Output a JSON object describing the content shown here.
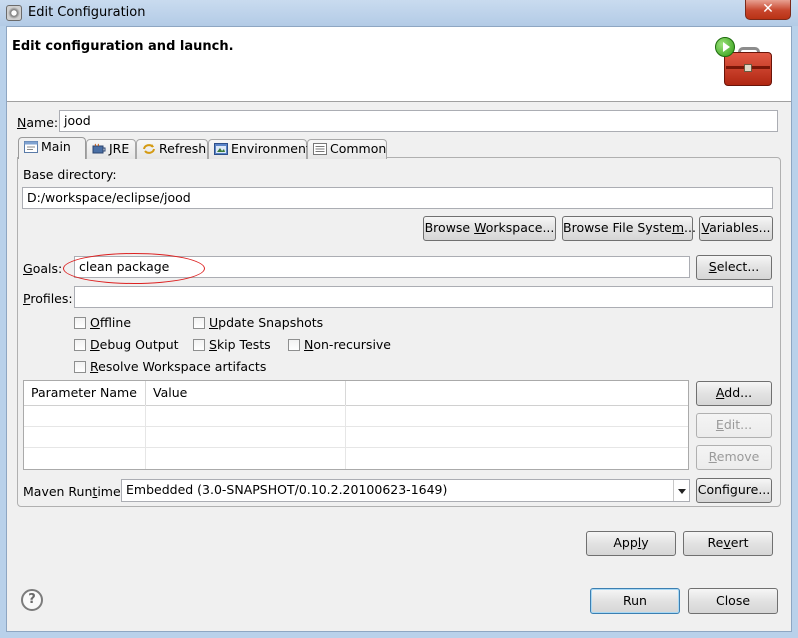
{
  "window": {
    "title": "Edit Configuration",
    "close_glyph": "✕"
  },
  "header": {
    "title": "Edit configuration and launch.",
    "icons": [
      "run-icon",
      "toolbox-icon"
    ]
  },
  "name": {
    "label_u": "N",
    "label_rest": "ame:",
    "value": "jood"
  },
  "tabs": [
    {
      "label": "Main",
      "icon": "main-tab-icon",
      "active": true
    },
    {
      "label": "JRE",
      "icon": "jre-icon",
      "active": false
    },
    {
      "label": "Refresh",
      "icon": "refresh-icon",
      "active": false
    },
    {
      "label": "Environment",
      "icon": "environment-icon",
      "active": false
    },
    {
      "label": "Common",
      "icon": "common-icon",
      "active": false
    }
  ],
  "main": {
    "base_dir_label": "Base directory:",
    "base_dir_value": "D:/workspace/eclipse/jood",
    "browse_workspace": {
      "pre": "Browse ",
      "u": "W",
      "post": "orkspace..."
    },
    "browse_filesystem": {
      "pre": "Browse File Syste",
      "u": "m",
      "post": "..."
    },
    "variables": {
      "pre": "",
      "u": "V",
      "post": "ariables..."
    },
    "goals_label": {
      "u": "G",
      "rest": "oals:"
    },
    "goals_value": "clean package",
    "select_button": {
      "u": "S",
      "rest": "elect..."
    },
    "profiles_label": {
      "u": "P",
      "rest": "rofiles:"
    },
    "profiles_value": "",
    "checkboxes": {
      "offline": {
        "u": "O",
        "rest": "ffline",
        "checked": false
      },
      "update_snapshots": {
        "u": "U",
        "rest": "pdate Snapshots",
        "checked": false
      },
      "debug_output": {
        "u": "D",
        "rest": "ebug Output",
        "checked": false
      },
      "skip_tests": {
        "u": "S",
        "rest": "kip Tests",
        "checked": false
      },
      "non_recursive": {
        "u": "N",
        "rest": "on-recursive",
        "checked": false
      },
      "resolve_workspace": {
        "u": "R",
        "rest": "esolve Workspace artifacts",
        "checked": false
      }
    },
    "params_table": {
      "columns": [
        "Parameter Name",
        "Value",
        ""
      ],
      "rows": []
    },
    "add_button": {
      "u": "A",
      "rest": "dd..."
    },
    "edit_button": {
      "u": "E",
      "rest": "dit..."
    },
    "remove_button": {
      "u": "R",
      "rest": "emove"
    },
    "runtime_label": {
      "pre": "Maven Run",
      "u": "t",
      "post": "ime:"
    },
    "runtime_value": "Embedded (3.0-SNAPSHOT/0.10.2.20100623-1649)",
    "configure_button": "Configure..."
  },
  "actions": {
    "apply": {
      "pre": "App",
      "u": "l",
      "post": "y"
    },
    "revert": {
      "pre": "Re",
      "u": "v",
      "post": "ert"
    },
    "run": "Run",
    "close": "Close",
    "help_glyph": "?"
  },
  "colors": {
    "annotation_ellipse": "#dd2222",
    "titlebar": "#b9d1ea",
    "close_button": "#c7452c"
  }
}
